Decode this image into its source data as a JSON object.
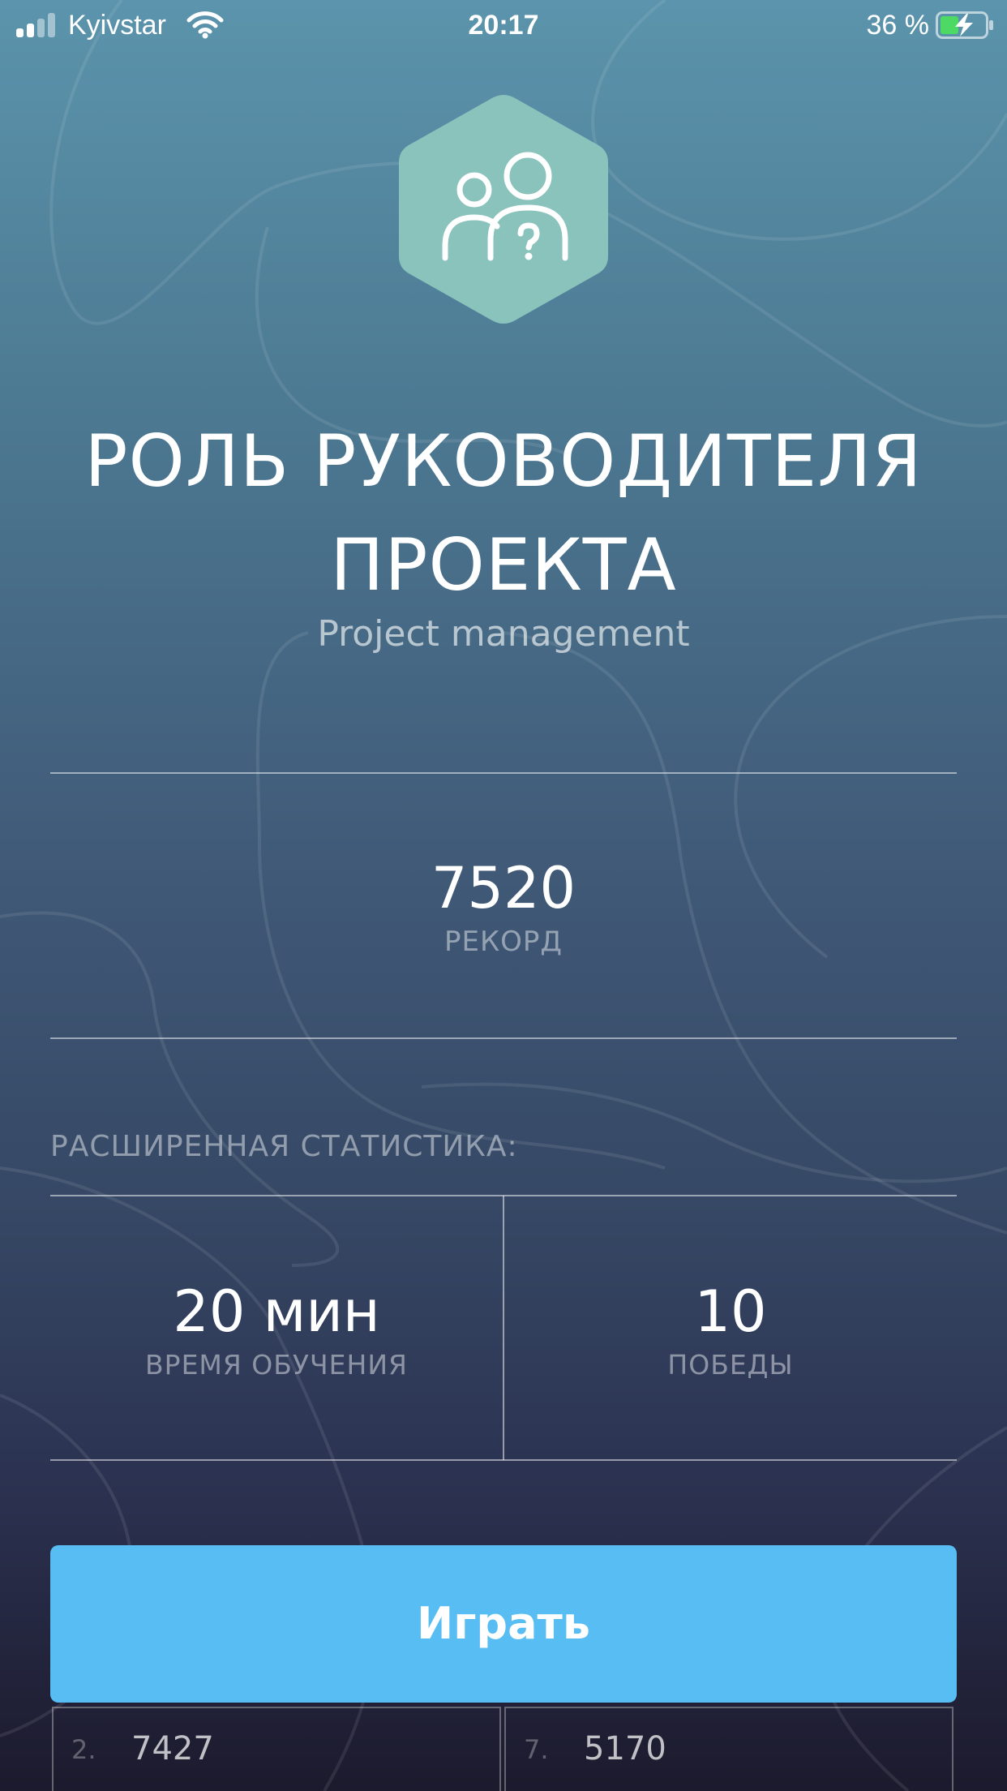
{
  "status_bar": {
    "carrier": "Kyivstar",
    "time": "20:17",
    "battery_percent": "36 %",
    "icons": [
      "signal-icon",
      "wifi-icon",
      "battery-charging-icon"
    ]
  },
  "hero": {
    "icon": "people-question-icon",
    "icon_color": "#8ac2bc",
    "title_line1": "РОЛЬ РУКОВОДИТЕЛЯ",
    "title_line2": "ПРОЕКТА",
    "subtitle": "Project management"
  },
  "record": {
    "value": "7520",
    "label": "РЕКОРД"
  },
  "extended_stats": {
    "heading": "РАСШИРЕННАЯ СТАТИСТИКА:",
    "items": [
      {
        "value": "20 мин",
        "label": "ВРЕМЯ ОБУЧЕНИЯ"
      },
      {
        "value": "10",
        "label": "ПОБЕДЫ"
      }
    ]
  },
  "play_button": {
    "label": "Играть",
    "color": "#58bdf2"
  },
  "leaderboard": [
    {
      "rank": "2.",
      "score": "7427"
    },
    {
      "rank": "7.",
      "score": "5170"
    }
  ]
}
